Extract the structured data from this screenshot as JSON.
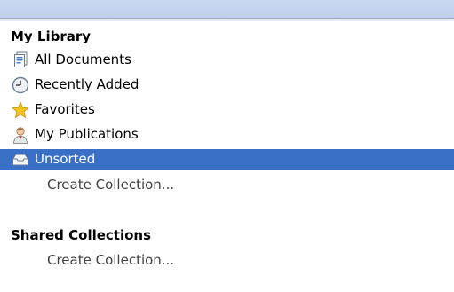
{
  "my_library": {
    "header": "My Library",
    "items": [
      {
        "label": "All Documents",
        "icon": "documents-icon"
      },
      {
        "label": "Recently Added",
        "icon": "clock-icon"
      },
      {
        "label": "Favorites",
        "icon": "star-icon"
      },
      {
        "label": "My Publications",
        "icon": "person-icon"
      },
      {
        "label": "Unsorted",
        "icon": "tray-icon",
        "selected": true
      }
    ],
    "create_label": "Create Collection..."
  },
  "shared": {
    "header": "Shared Collections",
    "create_label": "Create Collection..."
  },
  "colors": {
    "selection": "#3a6fc6",
    "star": "#f6c322"
  }
}
